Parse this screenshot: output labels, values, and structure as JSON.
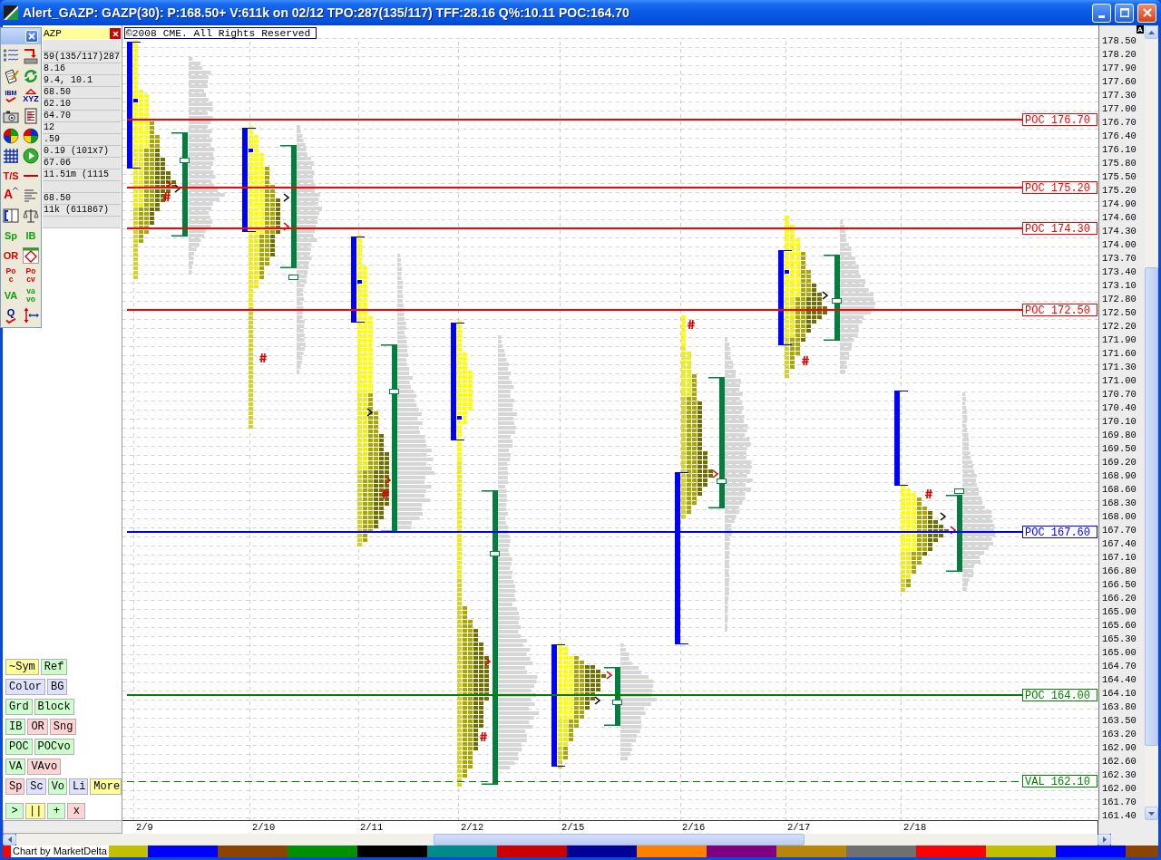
{
  "window": {
    "title": "Alert_GAZP: GAZP(30): P:168.50+ V:611k on 02/12 TPO:287(135/117) TFF:28.16 Q%:10.11 POC:164.70"
  },
  "floating_toolbar": {
    "tools": [
      {
        "kind": "icon"
      },
      {
        "kind": "icon"
      },
      {
        "kind": "icon"
      },
      {
        "kind": "icon"
      },
      {
        "kind": "check",
        "label": "IBM",
        "color": "#0000a0"
      },
      {
        "kind": "triangle",
        "label": "XYZ",
        "color": "#0000c0"
      },
      {
        "kind": "icon"
      },
      {
        "kind": "icon"
      },
      {
        "kind": "icon"
      },
      {
        "kind": "icon"
      },
      {
        "kind": "icon"
      },
      {
        "kind": "icon"
      },
      {
        "kind": "text",
        "label": "T/S",
        "color": "#e00000"
      },
      {
        "kind": "icon"
      },
      {
        "kind": "caret",
        "label": "A",
        "color": "#e00000"
      },
      {
        "kind": "icon"
      },
      {
        "kind": "icon"
      },
      {
        "kind": "icon"
      },
      {
        "kind": "text",
        "label": "Sp",
        "color": "#10a010"
      },
      {
        "kind": "text",
        "label": "IB",
        "color": "#10a010"
      },
      {
        "kind": "text",
        "label": "OR",
        "color": "#e00000"
      },
      {
        "kind": "icon"
      },
      {
        "kind": "stacked",
        "top": "Po",
        "bottom": "c",
        "color": "#e00000"
      },
      {
        "kind": "stacked",
        "top": "Po",
        "bottom": "cv",
        "color": "#e00000"
      },
      {
        "kind": "text",
        "label": "VA",
        "color": "#10a010"
      },
      {
        "kind": "stacked",
        "top": "va",
        "bottom": "vo",
        "color": "#10a010"
      },
      {
        "kind": "check",
        "label": "Q",
        "color": "#000080"
      },
      {
        "kind": "icon"
      }
    ]
  },
  "info_panel": {
    "symbol": "AZP",
    "groups": [
      [
        "59(135/117)287",
        "8.16",
        "9.4, 10.1",
        "68.50",
        "62.10",
        "64.70",
        "12",
        ".59",
        "0.19 (101x7)",
        "67.06",
        "11.51m (1115"
      ],
      [
        "68.50",
        "11k (611867)"
      ]
    ]
  },
  "option_buttons": [
    [
      {
        "label": "~Sym",
        "color": "#ffff99"
      },
      {
        "label": "Ref",
        "color": "#ccffcc"
      }
    ],
    [
      {
        "label": "Color",
        "color": "#e0e0ff"
      },
      {
        "label": "BG",
        "color": "#e0e0ff"
      }
    ],
    [
      {
        "label": "Grd",
        "color": "#ccffcc"
      },
      {
        "label": "Block",
        "color": "#ccffcc"
      }
    ],
    [
      {
        "label": "IB",
        "color": "#ccffcc"
      },
      {
        "label": "OR",
        "color": "#ffd4d4"
      },
      {
        "label": "Sng",
        "color": "#ffd4d4"
      }
    ],
    [
      {
        "label": "POC",
        "color": "#ccffcc"
      },
      {
        "label": "POCvo",
        "color": "#ccffcc"
      }
    ],
    [
      {
        "label": "VA",
        "color": "#ccffcc"
      },
      {
        "label": "VAvo",
        "color": "#ffd4d4"
      }
    ],
    [
      {
        "label": "Sp",
        "color": "#ffd4d4"
      },
      {
        "label": "Sc",
        "color": "#e0e0ff"
      },
      {
        "label": "Vo",
        "color": "#ccffcc"
      },
      {
        "label": "Li",
        "color": "#e0e0ff"
      },
      {
        "label": "More",
        "color": "#ffff99"
      }
    ],
    [
      {
        "label": ">",
        "color": "#ccffcc"
      },
      {
        "label": "||",
        "color": "#ffff99"
      },
      {
        "label": "+",
        "color": "#ccffcc"
      },
      {
        "label": "x",
        "color": "#ffd4d4"
      }
    ]
  ],
  "chart": {
    "copyright": "©2008 CME. All Rights Reserved",
    "reference_lines": [
      {
        "label": "POC 176.70",
        "color": "#ff0000",
        "dashed": false
      },
      {
        "label": "POC 175.20",
        "color": "#ff0000",
        "dashed": false
      },
      {
        "label": "POC 174.30",
        "color": "#ff0000",
        "dashed": false
      },
      {
        "label": "POC 172.50",
        "color": "#ff0000",
        "dashed": false
      },
      {
        "label": "POC 167.60",
        "color": "#0000ff",
        "dashed": false
      },
      {
        "label": "POC 164.00",
        "color": "#008000",
        "dashed": false
      },
      {
        "label": "VAL 162.10",
        "color": "#008000",
        "dashed": true
      }
    ],
    "scale_badge": "A",
    "price_labels": [
      "178.50",
      "178.20",
      "177.90",
      "177.60",
      "177.30",
      "177.00",
      "176.70",
      "176.40",
      "176.10",
      "175.80",
      "175.50",
      "175.20",
      "174.90",
      "174.60",
      "174.30",
      "174.00",
      "173.70",
      "173.40",
      "173.10",
      "172.80",
      "172.50",
      "172.20",
      "171.90",
      "171.60",
      "171.30",
      "171.00",
      "170.70",
      "170.40",
      "170.10",
      "169.80",
      "169.50",
      "169.20",
      "168.90",
      "168.60",
      "168.30",
      "168.00",
      "167.70",
      "167.40",
      "167.10",
      "166.80",
      "166.50",
      "166.20",
      "165.90",
      "165.60",
      "165.30",
      "165.00",
      "164.70",
      "164.40",
      "164.10",
      "163.80",
      "163.50",
      "163.20",
      "162.90",
      "162.60",
      "162.30",
      "162.00",
      "161.70",
      "161.40"
    ],
    "dates": [
      "2/9",
      "2/10",
      "2/11",
      "2/12",
      "2/15",
      "2/16",
      "2/17",
      "2/18"
    ]
  },
  "footer": {
    "credit": "Chart by MarketDelta",
    "swatches": [
      {
        "color": "#ff0000"
      },
      {
        "color": "#c0c000"
      },
      {
        "color": "#0000ff"
      },
      {
        "color": "#8b4500"
      },
      {
        "color": "#009000"
      },
      {
        "color": "#000000"
      },
      {
        "color": "#008b8b"
      },
      {
        "color": "#cc0000"
      },
      {
        "color": "#000099"
      },
      {
        "color": "#ff8000"
      },
      {
        "color": "#800080"
      },
      {
        "color": "#b8860b"
      },
      {
        "color": "#707070"
      },
      {
        "color": "#ff0000"
      },
      {
        "color": "#c0c000"
      },
      {
        "color": "#0000ff"
      },
      {
        "color": "#8b4500"
      }
    ]
  }
}
